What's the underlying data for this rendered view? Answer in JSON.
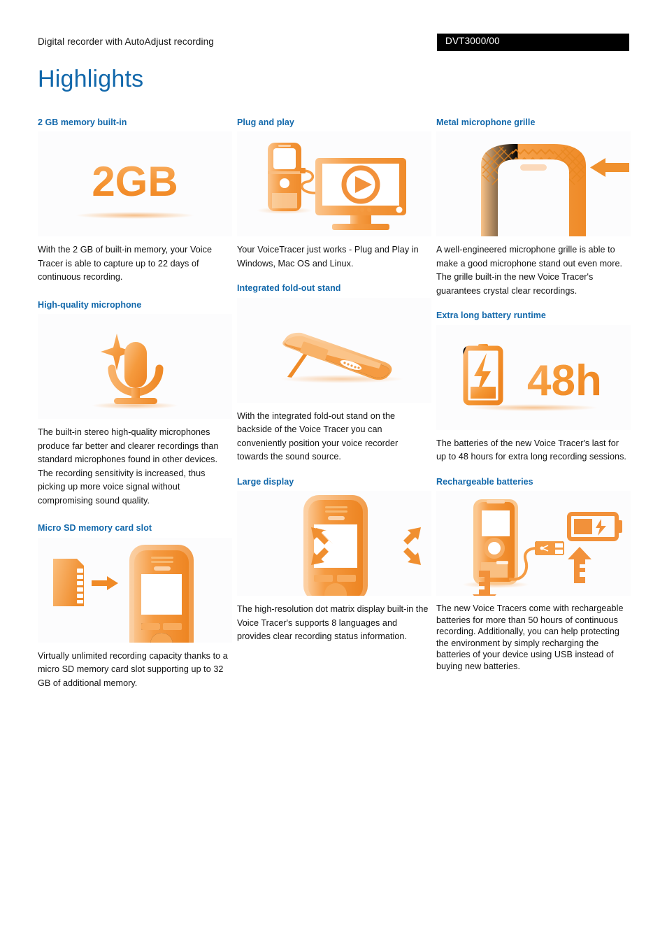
{
  "header": {
    "subtitle": "Digital recorder with AutoAdjust recording",
    "sku": "DVT3000/00",
    "title": "Highlights"
  },
  "colors": {
    "heading_blue": "#1268ab",
    "title_blue": "#1268ab",
    "accent_orange": "#f59331",
    "accent_orange_light": "#f8b26a",
    "accent_orange_dark": "#ed8122",
    "sku_bar": "#000000",
    "body_text": "#111111",
    "figure_bg": "#fcfcfd"
  },
  "columns": [
    {
      "id": "column-1",
      "sections": [
        {
          "id": "memory-built-in",
          "title": "2 GB memory built-in",
          "figure": "2gb-text-graphic",
          "figure_label": "2GB",
          "body": "With the 2 GB of built-in memory, your Voice Tracer is able to capture up to 22 days of continuous recording."
        },
        {
          "id": "high-quality-microphone",
          "title": "High-quality microphone",
          "figure": "microphone-sparkle-graphic",
          "body": "The built-in stereo high-quality microphones produce far better and clearer recordings than standard microphones found in other devices. The recording sensitivity is increased, thus picking up more voice signal without compromising sound quality."
        },
        {
          "id": "micro-sd-memory-card-slot",
          "title": "Micro SD memory card slot",
          "figure": "microsd-card-into-recorder-graphic",
          "body": "Virtually unlimited recording capacity thanks to a micro SD memory card slot supporting up to 32 GB of additional memory."
        }
      ]
    },
    {
      "id": "column-2",
      "sections": [
        {
          "id": "plug-and-play",
          "title": "Plug and play",
          "figure": "recorder-connected-to-monitor-graphic",
          "body": "Your VoiceTracer just works - Plug and Play in Windows, Mac OS and Linux."
        },
        {
          "id": "integrated-fold-out-stand",
          "title": "Integrated fold-out stand",
          "figure": "recorder-on-fold-out-stand-graphic",
          "body": "With the integrated fold-out stand on the backside of the Voice Tracer you can conveniently position your voice recorder towards the sound source."
        },
        {
          "id": "large-display",
          "title": "Large display",
          "figure": "recorder-large-display-arrows-graphic",
          "body": "The high-resolution dot matrix display built-in the Voice Tracer's supports 8 languages and provides clear recording status information."
        }
      ]
    },
    {
      "id": "column-3",
      "sections": [
        {
          "id": "metal-microphone-grille",
          "title": "Metal microphone grille",
          "figure": "microphone-grille-arrow-graphic",
          "body": "A well-engineered microphone grille is able to make a good microphone stand out even more. The grille built-in the new Voice Tracer's guarantees crystal clear recordings."
        },
        {
          "id": "extra-long-battery-runtime",
          "title": "Extra long battery runtime",
          "figure": "battery-48h-graphic",
          "figure_label": "48h",
          "body": "The batteries of the new Voice Tracer's last for up to 48 hours for extra long recording sessions."
        },
        {
          "id": "rechargeable-batteries",
          "title": "Rechargeable batteries",
          "figure": "recorder-usb-charging-graphic",
          "body": "The new Voice Tracers come with rechargeable batteries for more than 50 hours of continuous recording. Additionally, you can help protecting the environment by simply recharging the batteries of your device using USB instead of buying new batteries."
        }
      ]
    }
  ]
}
